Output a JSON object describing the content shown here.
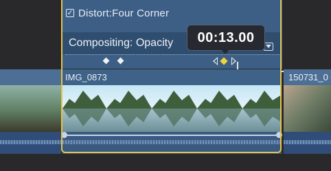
{
  "effect": {
    "name": "Distort:Four Corner",
    "enabled": true
  },
  "compositing": {
    "label": "Compositing: Opacity"
  },
  "playhead": {
    "timecode": "00:13.00"
  },
  "clips": {
    "left": {
      "name": ""
    },
    "main": {
      "name": "IMG_0873"
    },
    "right": {
      "name": "150731_0"
    }
  },
  "colors": {
    "selection": "#e5c44a",
    "active_keyframe": "#f2d23a",
    "clip_blue": "#3f6289"
  },
  "icons": {
    "checkbox": "checkbox-checked-icon",
    "dropdown": "dropdown-icon",
    "keyframe": "keyframe-diamond-icon"
  }
}
